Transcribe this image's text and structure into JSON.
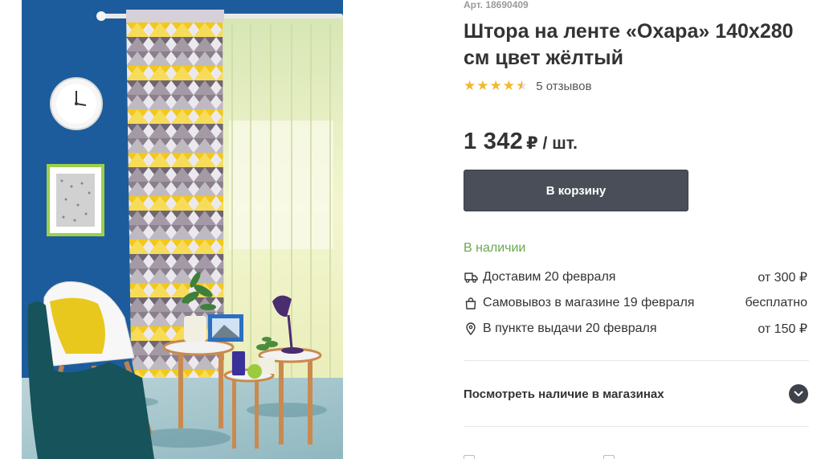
{
  "product": {
    "article": "Арт. 18690409",
    "title": "Штора на ленте «Охара» 140x280 см цвет жёлтый",
    "rating": 4.5,
    "reviews": "5 отзывов",
    "price_value": "1 342",
    "price_unit": "₽ / шт.",
    "cart_button": "В корзину"
  },
  "availability": {
    "status": "В наличии",
    "status_color": "#6aa84f",
    "options": [
      {
        "icon": "truck-icon",
        "label": "Доставим 20 февраля",
        "price": "от 300 ₽"
      },
      {
        "icon": "shopping-bag-icon",
        "label": "Самовывоз в магазине 19 февраля",
        "price": "бесплатно"
      },
      {
        "icon": "location-pin-icon",
        "label": "В пункте выдачи 20 февраля",
        "price": "от 150 ₽"
      }
    ]
  },
  "stores": {
    "label": "Посмотреть наличие в магазинах",
    "icon": "chevron-down-icon"
  },
  "colors": {
    "button": "#4a4e59",
    "star": "#f3b92b",
    "wall": "#1c5c9c",
    "curtain_yellow": "#f2c81c"
  }
}
